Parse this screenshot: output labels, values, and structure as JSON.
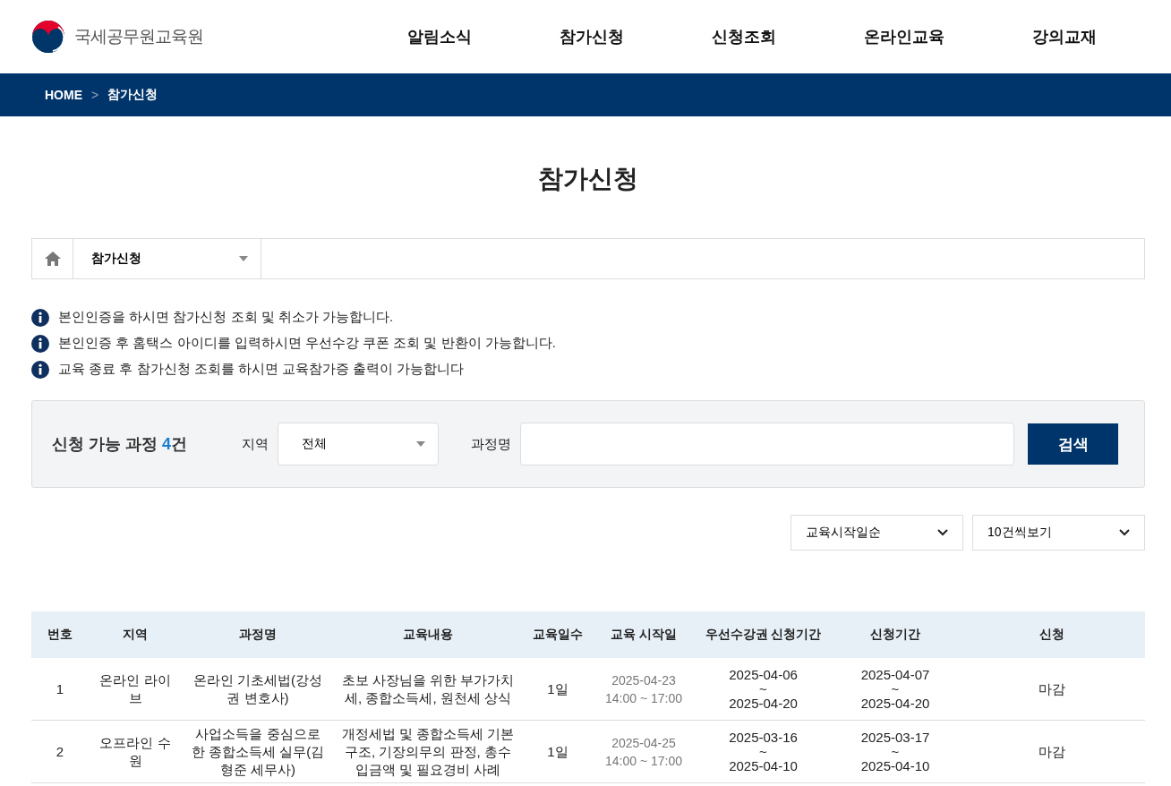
{
  "header": {
    "logo_text": "국세공무원교육원",
    "nav": [
      {
        "label": "알림소식"
      },
      {
        "label": "참가신청"
      },
      {
        "label": "신청조회"
      },
      {
        "label": "온라인교육"
      },
      {
        "label": "강의교재"
      }
    ]
  },
  "breadcrumb": {
    "home": "HOME",
    "separator": ">",
    "current": "참가신청"
  },
  "page_title": "참가신청",
  "location_bar": {
    "menu": "참가신청"
  },
  "notices": [
    "본인인증을 하시면 참가신청 조회 및 취소가 가능합니다.",
    "본인인증 후 홈택스 아이디를 입력하시면 우선수강 쿠폰 조회 및 반환이 가능합니다.",
    "교육 종료 후 참가신청 조회를 하시면 교육참가증 출력이 가능합니다"
  ],
  "search": {
    "count_label": "신청 가능 과정",
    "count": "4",
    "count_unit": "건",
    "region_label": "지역",
    "region_value": "전체",
    "course_label": "과정명",
    "button": "검색"
  },
  "sort": {
    "order": "교육시작일순",
    "page_size": "10건씩보기"
  },
  "table": {
    "columns": [
      "번호",
      "지역",
      "과정명",
      "교육내용",
      "교육일수",
      "교육 시작일",
      "우선수강권 신청기간",
      "신청기간",
      "신청"
    ],
    "rows": [
      {
        "no": "1",
        "region": "온라인 라이브",
        "course": "온라인 기초세법(강성권 변호사)",
        "content": "초보 사장님을 위한 부가가치세, 종합소득세, 원천세 상식",
        "days": "1일",
        "start": [
          "2025-04-23",
          "14:00 ~ 17:00"
        ],
        "priority_period": [
          "2025-04-06",
          "~",
          "2025-04-20"
        ],
        "period": [
          "2025-04-07",
          "~",
          "2025-04-20"
        ],
        "status": "마감"
      },
      {
        "no": "2",
        "region": "오프라인 수원",
        "course": "사업소득을 중심으로 한 종합소득세 실무(김형준 세무사)",
        "content": "개정세법 및 종합소득세 기본구조, 기장의무의 판정, 총수입금액 및 필요경비 사례",
        "days": "1일",
        "start": [
          "2025-04-25",
          "14:00 ~ 17:00"
        ],
        "priority_period": [
          "2025-03-16",
          "~",
          "2025-04-10"
        ],
        "period": [
          "2025-03-17",
          "~",
          "2025-04-10"
        ],
        "status": "마감"
      }
    ]
  }
}
